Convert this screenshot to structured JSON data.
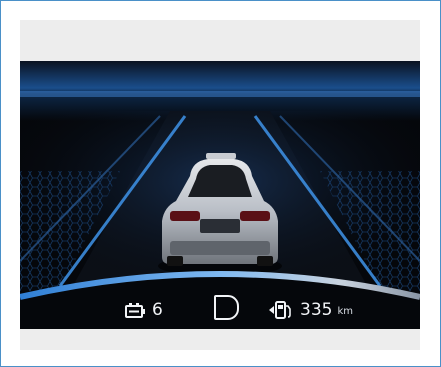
{
  "cluster": {
    "battery_icon": "battery-icon",
    "battery_value": "6",
    "gear": "D",
    "fuel_icon": "fuel-pump-icon",
    "range_value": "335",
    "range_unit": "km"
  },
  "colors": {
    "accent_blue": "#2f7fd6",
    "background": "#05070b",
    "text": "#f2f4f7",
    "frame_border": "#4a90c8",
    "panel_gray": "#ededed"
  }
}
